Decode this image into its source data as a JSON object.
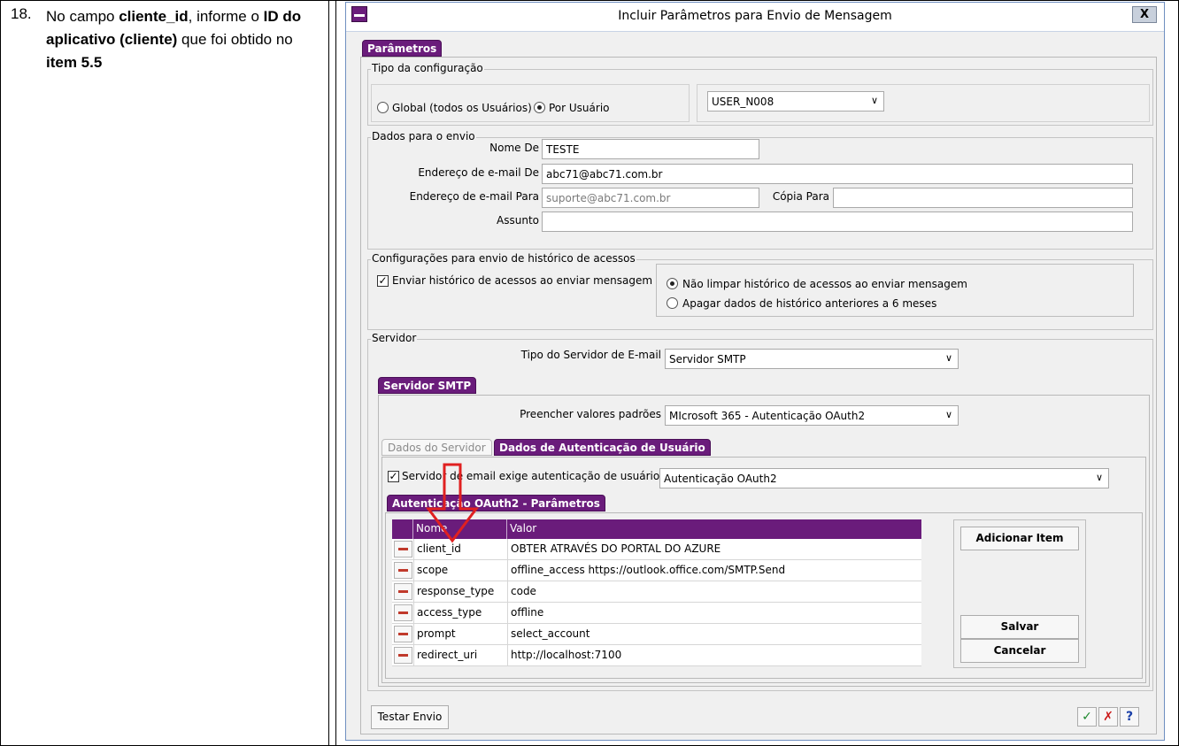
{
  "doc": {
    "step_number": "18.",
    "instruction": {
      "p1": "No campo ",
      "b1": "cliente_id",
      "p2": ", informe o ",
      "b2": "ID do aplicativo (cliente)",
      "p3": " que foi obtido no ",
      "b3": "item 5.5"
    }
  },
  "window": {
    "title": "Incluir Parâmetros para Envio de Mensagem",
    "close_label": "X",
    "main_tab": "Parâmetros"
  },
  "config_type": {
    "legend": "Tipo da configuração",
    "radio_global_label": "Global (todos os Usuários)",
    "radio_user_label": "Por Usuário",
    "selected": "user",
    "user_select_value": "USER_N008"
  },
  "send_data": {
    "legend": "Dados para o envio",
    "nome_de_label": "Nome De",
    "nome_de_value": "TESTE",
    "email_de_label": "Endereço de e-mail De",
    "email_de_value": "abc71@abc71.com.br",
    "email_para_label": "Endereço de e-mail Para",
    "email_para_value": "suporte@abc71.com.br",
    "copia_label": "Cópia Para",
    "copia_value": "",
    "assunto_label": "Assunto",
    "assunto_value": ""
  },
  "history": {
    "legend": "Configurações para envio de histórico de acessos",
    "send_history_label": "Enviar histórico de acessos ao enviar mensagem",
    "send_history_checked": true,
    "opt_keep_label": "Não limpar histórico de acessos ao enviar mensagem",
    "opt_delete_label": "Apagar dados de histórico anteriores a 6 meses",
    "selected": "keep"
  },
  "server": {
    "legend": "Servidor",
    "type_label": "Tipo do Servidor de E-mail",
    "type_value": "Servidor SMTP",
    "smtp_tab": "Servidor SMTP",
    "defaults_label": "Preencher valores padrões",
    "defaults_value": "MIcrosoft 365 - Autenticação OAuth2",
    "subtab_server": "Dados do Servidor",
    "subtab_auth": "Dados de Autenticação de Usuário",
    "requires_auth_label": "Servidor de email exige autenticação de usuário",
    "requires_auth_checked": true,
    "auth_type_value": "Autenticação OAuth2",
    "oauth_tab": "Autenticação OAuth2 - Parâmetros"
  },
  "oauth_table": {
    "columns": [
      "Nome",
      "Valor"
    ],
    "rows": [
      {
        "name": "client_id",
        "value": "OBTER ATRAVÉS DO PORTAL DO AZURE"
      },
      {
        "name": "scope",
        "value": "offline_access https://outlook.office.com/SMTP.Send"
      },
      {
        "name": "response_type",
        "value": "code"
      },
      {
        "name": "access_type",
        "value": "offline"
      },
      {
        "name": "prompt",
        "value": "select_account"
      },
      {
        "name": "redirect_uri",
        "value": "http://localhost:7100"
      }
    ],
    "add_item_label": "Adicionar Item",
    "save_label": "Salvar",
    "cancel_label": "Cancelar"
  },
  "footer": {
    "test_send_label": "Testar Envio",
    "confirm_icon": "✓",
    "cancel_icon": "✗",
    "help_icon": "?"
  },
  "colors": {
    "accent": "#6a1c7b",
    "annotation_arrow": "#e02020",
    "confirm": "#1e8a2e",
    "cancel": "#cc1b1b",
    "help": "#1a3fa8"
  }
}
